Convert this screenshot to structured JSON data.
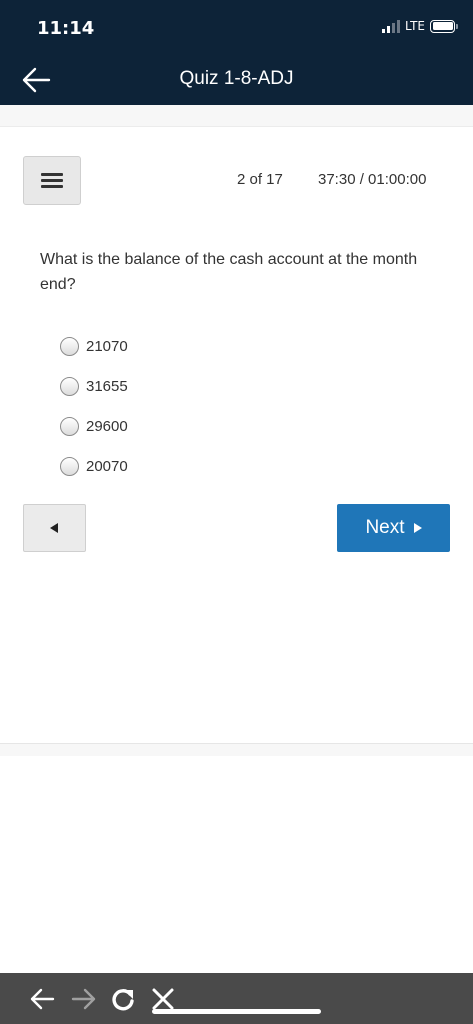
{
  "status_bar": {
    "time": "11:14",
    "network": "LTE"
  },
  "header": {
    "title": "Quiz 1-8-ADJ",
    "back_icon": "arrow-left-icon"
  },
  "quiz": {
    "progress": "2 of 17",
    "timer": "37:30 / 01:00:00",
    "question": "What is the balance of the cash account at the month end?",
    "options": [
      {
        "label": "21070"
      },
      {
        "label": "31655"
      },
      {
        "label": "29600"
      },
      {
        "label": "20070"
      }
    ],
    "prev_icon": "triangle-left-icon",
    "next_label": "Next",
    "next_icon": "triangle-right-icon"
  },
  "browser_bar": {
    "icons": [
      "back-arrow-icon",
      "forward-arrow-icon",
      "reload-icon",
      "close-icon"
    ]
  },
  "colors": {
    "header_bg": "#0d2338",
    "next_button": "#1f76b8",
    "browser_bar_bg": "#4a4a4a"
  }
}
